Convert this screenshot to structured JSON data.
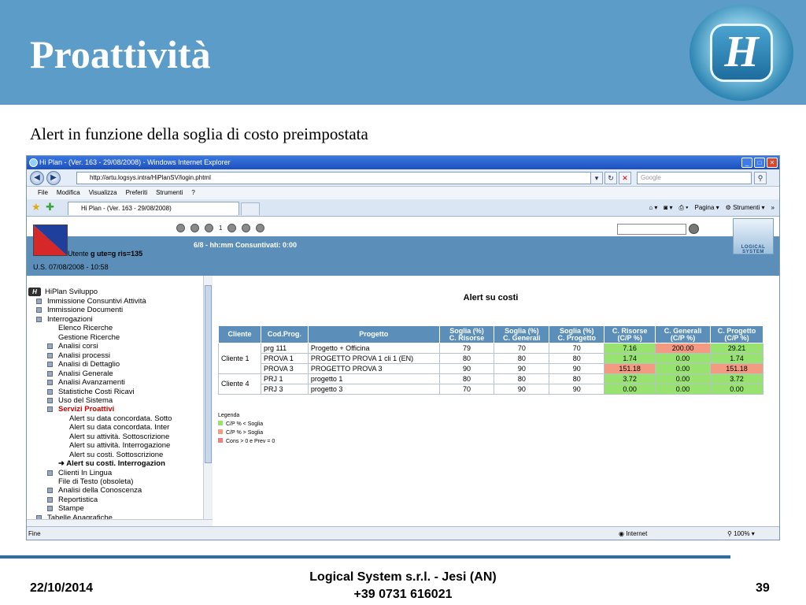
{
  "slide": {
    "title": "Proattività",
    "logo_letter": "H",
    "subtitle": "Alert in funzione della soglia di costo preimpostata",
    "footer_date": "22/10/2014",
    "footer_company": "Logical System s.r.l. - Jesi (AN)",
    "footer_phone": "+39 0731 616021",
    "page_number": "39"
  },
  "browser": {
    "window_title": "Hi Plan - (Ver. 163 - 29/08/2008) - Windows Internet Explorer",
    "address": "http://artu.logsys.intra/HiPlanSV/login.phtml",
    "search_placeholder": "Google",
    "menu": [
      "File",
      "Modifica",
      "Visualizza",
      "Preferiti",
      "Strumenti",
      "?"
    ],
    "tab_title": "Hi Plan - (Ver. 163 - 29/08/2008)",
    "cmd_page": "Pagina",
    "cmd_tools": "Strumenti",
    "status_text": "Fine",
    "status_zone": "Internet",
    "status_zoom": "100%"
  },
  "app": {
    "toolbar_counter": "1",
    "user_prefix": "Utente",
    "user_value": "g ute=g ris=135",
    "consuntivati": "6/8 - hh:mm Consuntivati: 0:00",
    "date_line": "U.S. 07/08/2008 - 10:58",
    "company_logo_text": "LOGICAL SYSTEM"
  },
  "tree": {
    "root": "HiPlan Sviluppo",
    "items": [
      {
        "label": "Immissione Consuntivi Attività",
        "level": 1,
        "bullet": true
      },
      {
        "label": "Immissione Documenti",
        "level": 1,
        "bullet": true
      },
      {
        "label": "Interrogazioni",
        "level": 1,
        "bullet": true
      },
      {
        "label": "Elenco Ricerche",
        "level": 2,
        "bullet": false
      },
      {
        "label": "Gestione Ricerche",
        "level": 2,
        "bullet": false
      },
      {
        "label": "Analisi corsi",
        "level": 2,
        "bullet": true
      },
      {
        "label": "Analisi processi",
        "level": 2,
        "bullet": true
      },
      {
        "label": "Analisi di Dettaglio",
        "level": 2,
        "bullet": true
      },
      {
        "label": "Analisi Generale",
        "level": 2,
        "bullet": true
      },
      {
        "label": "Analisi Avanzamenti",
        "level": 2,
        "bullet": true
      },
      {
        "label": "Statistiche Costi Ricavi",
        "level": 2,
        "bullet": true
      },
      {
        "label": "Uso del Sistema",
        "level": 2,
        "bullet": true
      },
      {
        "label": "Servizi Proattivi",
        "level": 2,
        "bullet": true,
        "active": true
      },
      {
        "label": "Alert su data concordata. Sotto",
        "level": 3,
        "bullet": false
      },
      {
        "label": "Alert su data concordata. Inter",
        "level": 3,
        "bullet": false
      },
      {
        "label": "Alert su attività. Sottoscrizione",
        "level": 3,
        "bullet": false
      },
      {
        "label": "Alert su attività. Interrogazione",
        "level": 3,
        "bullet": false
      },
      {
        "label": "Alert su costi. Sottoscrizione",
        "level": 3,
        "bullet": false
      },
      {
        "label": "Alert su costi. Interrogazion",
        "level": 3,
        "bullet": false,
        "selected": true
      },
      {
        "label": "Clienti In Lingua",
        "level": 2,
        "bullet": true
      },
      {
        "label": "File di Testo (obsoleta)",
        "level": 2,
        "bullet": false
      },
      {
        "label": "Analisi della Conoscenza",
        "level": 2,
        "bullet": true
      },
      {
        "label": "Reportistica",
        "level": 2,
        "bullet": true
      },
      {
        "label": "Stampe",
        "level": 2,
        "bullet": true
      },
      {
        "label": "Tabelle Anagrafiche",
        "level": 1,
        "bullet": true
      }
    ]
  },
  "alerts": {
    "title": "Alert su costi",
    "headers": [
      "Cliente",
      "Cod.Prog.",
      "Progetto",
      "Soglia (%)\nC. Risorse",
      "Soglia (%)\nC. Generali",
      "Soglia (%)\nC. Progetto",
      "C. Risorse\n(C/P %)",
      "C. Generali\n(C/P %)",
      "C. Progetto\n(C/P %)"
    ],
    "groups": [
      {
        "cliente": "Cliente 1",
        "rows": [
          {
            "cod": "prg 111",
            "progetto": "Progetto + Officina",
            "s_ris": "79",
            "s_gen": "70",
            "s_prog": "70",
            "c_ris": "7.16",
            "c_ris_status": "green",
            "c_gen": "200.00",
            "c_gen_status": "red",
            "c_prog": "29.21",
            "c_prog_status": "green"
          },
          {
            "cod": "PROVA 1",
            "progetto": "PROGETTO PROVA 1 cli 1 (EN)",
            "s_ris": "80",
            "s_gen": "80",
            "s_prog": "80",
            "c_ris": "1.74",
            "c_ris_status": "green",
            "c_gen": "0.00",
            "c_gen_status": "green",
            "c_prog": "1.74",
            "c_prog_status": "green"
          },
          {
            "cod": "PROVA 3",
            "progetto": "PROGETTO PROVA 3",
            "s_ris": "90",
            "s_gen": "90",
            "s_prog": "90",
            "c_ris": "151.18",
            "c_ris_status": "red",
            "c_gen": "0.00",
            "c_gen_status": "green",
            "c_prog": "151.18",
            "c_prog_status": "red"
          }
        ]
      },
      {
        "cliente": "Cliente 4",
        "rows": [
          {
            "cod": "PRJ 1",
            "progetto": "progetto 1",
            "s_ris": "80",
            "s_gen": "80",
            "s_prog": "80",
            "c_ris": "3.72",
            "c_ris_status": "green",
            "c_gen": "0.00",
            "c_gen_status": "green",
            "c_prog": "3.72",
            "c_prog_status": "green"
          },
          {
            "cod": "PRJ 3",
            "progetto": "progetto 3",
            "s_ris": "70",
            "s_gen": "90",
            "s_prog": "90",
            "c_ris": "0.00",
            "c_ris_status": "green",
            "c_gen": "0.00",
            "c_gen_status": "green",
            "c_prog": "0.00",
            "c_prog_status": "green"
          }
        ]
      }
    ],
    "legend_title": "Legenda",
    "legend": [
      {
        "label": "C/P % < Soglia",
        "color": "#98e36f"
      },
      {
        "label": "C/P % > Soglia",
        "color": "#f39a82"
      },
      {
        "label": "Cons > 0 e Prev = 0",
        "color": "#ef8080"
      }
    ]
  },
  "colors": {
    "header_blue": "#5b9cc8",
    "table_header": "#5b8fb9",
    "ok_green": "#98e36f",
    "over_red": "#f39a82",
    "active_menu": "#cc0000"
  }
}
